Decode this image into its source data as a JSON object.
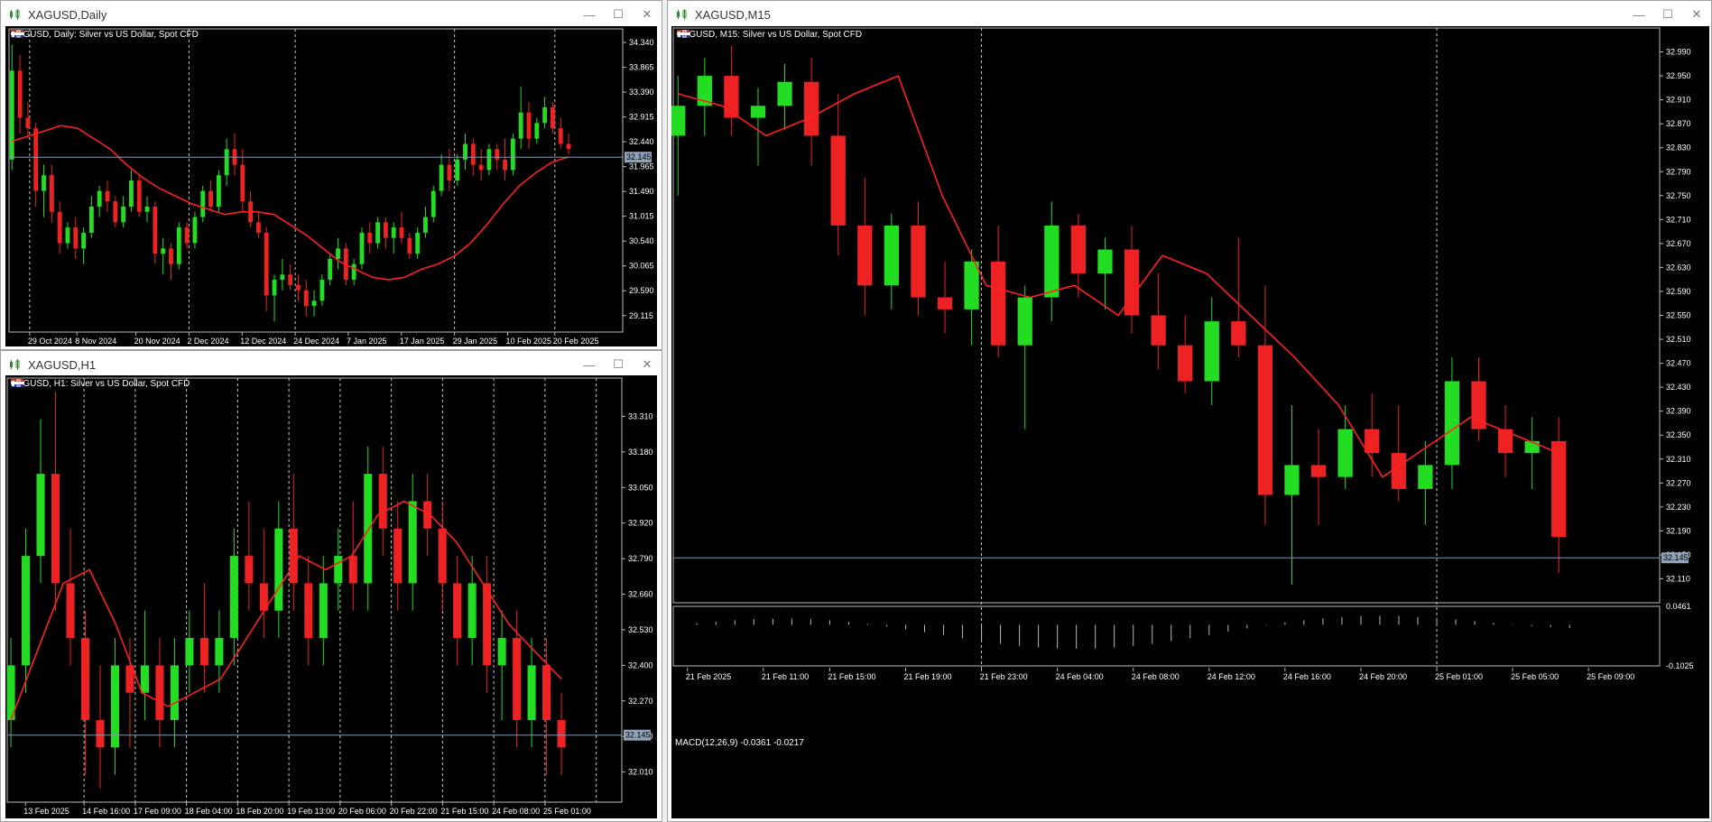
{
  "colors": {
    "bull": "#22dd22",
    "bear": "#ee2222",
    "ma": "#ff2020",
    "grid": "#c8c8c8",
    "bg": "#000000",
    "axis_text": "#ffffff",
    "price_badge": "#8fa3b8"
  },
  "windows": {
    "daily": {
      "title": "XAGUSD,Daily",
      "caption": "XAGUSD, Daily:  Silver vs US Dollar, Spot CFD",
      "price_label": "32.145"
    },
    "h1": {
      "title": "XAGUSD,H1",
      "caption": "XAGUSD, H1:  Silver vs US Dollar, Spot CFD",
      "price_label": "32.145"
    },
    "m15": {
      "title": "XAGUSD,M15",
      "caption": "XAGUSD, M15:  Silver vs US Dollar, Spot CFD",
      "price_label": "32.145",
      "macd_caption": "MACD(12,26,9) -0.0361 -0.0217"
    }
  },
  "chart_data": [
    {
      "id": "daily",
      "type": "candlestick",
      "ylim": [
        28.8,
        34.6
      ],
      "yticks": [
        34.34,
        33.865,
        33.39,
        32.915,
        32.44,
        31.965,
        31.49,
        31.015,
        30.54,
        30.065,
        29.59,
        29.115
      ],
      "xticks": [
        {
          "label": "29 Oct 2024",
          "bar": 3
        },
        {
          "label": "8 Nov 2024",
          "bar": 11
        },
        {
          "label": "20 Nov 2024",
          "bar": 21
        },
        {
          "label": "2 Dec 2024",
          "bar": 30
        },
        {
          "label": "12 Dec 2024",
          "bar": 39
        },
        {
          "label": "24 Dec 2024",
          "bar": 48
        },
        {
          "label": "7 Jan 2025",
          "bar": 57
        },
        {
          "label": "17 Jan 2025",
          "bar": 66
        },
        {
          "label": "29 Jan 2025",
          "bar": 75
        },
        {
          "label": "10 Feb 2025",
          "bar": 84
        },
        {
          "label": "20 Feb 2025",
          "bar": 92
        }
      ],
      "vgrid_bars": [
        3,
        30,
        48,
        75,
        92
      ],
      "bars_total": 104,
      "last_price": 32.145,
      "ma": [
        32.45,
        32.55,
        32.65,
        32.75,
        32.7,
        32.5,
        32.3,
        32.0,
        31.75,
        31.55,
        31.4,
        31.25,
        31.15,
        31.05,
        31.1,
        31.1,
        31.05,
        30.85,
        30.65,
        30.4,
        30.15,
        30.0,
        29.85,
        29.8,
        29.85,
        30.0,
        30.1,
        30.25,
        30.5,
        30.85,
        31.25,
        31.6,
        31.85,
        32.05,
        32.15
      ],
      "candles": [
        [
          32.1,
          34.3,
          31.9,
          33.8
        ],
        [
          33.8,
          34.1,
          32.6,
          32.9
        ],
        [
          32.9,
          33.2,
          32.5,
          32.7
        ],
        [
          32.7,
          32.8,
          31.2,
          31.5
        ],
        [
          31.5,
          32.0,
          31.0,
          31.8
        ],
        [
          31.8,
          32.0,
          30.9,
          31.1
        ],
        [
          31.1,
          31.3,
          30.3,
          30.5
        ],
        [
          30.5,
          30.9,
          30.4,
          30.8
        ],
        [
          30.8,
          31.0,
          30.2,
          30.4
        ],
        [
          30.4,
          30.8,
          30.1,
          30.7
        ],
        [
          30.7,
          31.4,
          30.6,
          31.2
        ],
        [
          31.2,
          31.6,
          31.0,
          31.5
        ],
        [
          31.5,
          31.7,
          31.1,
          31.3
        ],
        [
          31.3,
          31.4,
          30.8,
          30.9
        ],
        [
          30.9,
          31.4,
          30.8,
          31.2
        ],
        [
          31.2,
          31.9,
          31.1,
          31.7
        ],
        [
          31.7,
          31.8,
          31.0,
          31.1
        ],
        [
          31.1,
          31.4,
          30.9,
          31.2
        ],
        [
          31.2,
          31.3,
          30.1,
          30.3
        ],
        [
          30.3,
          30.6,
          29.9,
          30.4
        ],
        [
          30.4,
          30.5,
          29.8,
          30.1
        ],
        [
          30.1,
          30.9,
          30.0,
          30.8
        ],
        [
          30.8,
          30.9,
          30.4,
          30.5
        ],
        [
          30.5,
          31.1,
          30.4,
          31.0
        ],
        [
          31.0,
          31.6,
          30.9,
          31.5
        ],
        [
          31.5,
          31.7,
          31.1,
          31.2
        ],
        [
          31.2,
          31.9,
          31.1,
          31.8
        ],
        [
          31.8,
          32.5,
          31.6,
          32.3
        ],
        [
          32.3,
          32.6,
          31.8,
          32.0
        ],
        [
          32.0,
          32.3,
          31.1,
          31.3
        ],
        [
          31.3,
          31.5,
          30.8,
          30.9
        ],
        [
          30.9,
          31.1,
          30.6,
          30.7
        ],
        [
          30.7,
          30.8,
          29.2,
          29.5
        ],
        [
          29.5,
          29.9,
          29.0,
          29.8
        ],
        [
          29.8,
          30.2,
          29.6,
          29.9
        ],
        [
          29.9,
          30.1,
          29.6,
          29.7
        ],
        [
          29.7,
          29.9,
          29.4,
          29.6
        ],
        [
          29.6,
          29.8,
          29.1,
          29.3
        ],
        [
          29.3,
          29.6,
          29.1,
          29.4
        ],
        [
          29.4,
          29.9,
          29.3,
          29.8
        ],
        [
          29.8,
          30.3,
          29.7,
          30.2
        ],
        [
          30.2,
          30.6,
          30.0,
          30.4
        ],
        [
          30.4,
          30.5,
          29.7,
          29.8
        ],
        [
          29.8,
          30.2,
          29.7,
          30.1
        ],
        [
          30.1,
          30.8,
          30.0,
          30.7
        ],
        [
          30.7,
          30.9,
          30.3,
          30.5
        ],
        [
          30.5,
          31.0,
          30.4,
          30.9
        ],
        [
          30.9,
          31.0,
          30.4,
          30.6
        ],
        [
          30.6,
          30.9,
          30.3,
          30.8
        ],
        [
          30.8,
          31.1,
          30.5,
          30.6
        ],
        [
          30.6,
          30.7,
          30.2,
          30.3
        ],
        [
          30.3,
          30.8,
          30.2,
          30.7
        ],
        [
          30.7,
          31.2,
          30.6,
          31.0
        ],
        [
          31.0,
          31.6,
          30.9,
          31.5
        ],
        [
          31.5,
          32.2,
          31.4,
          32.0
        ],
        [
          32.0,
          32.3,
          31.5,
          31.7
        ],
        [
          31.7,
          32.2,
          31.6,
          32.1
        ],
        [
          32.1,
          32.6,
          31.9,
          32.4
        ],
        [
          32.4,
          32.5,
          31.8,
          32.0
        ],
        [
          32.0,
          32.3,
          31.7,
          31.9
        ],
        [
          31.9,
          32.4,
          31.8,
          32.3
        ],
        [
          32.3,
          32.4,
          31.9,
          32.1
        ],
        [
          32.1,
          32.5,
          31.7,
          31.9
        ],
        [
          31.9,
          32.6,
          31.8,
          32.5
        ],
        [
          32.5,
          33.5,
          32.3,
          33.0
        ],
        [
          33.0,
          33.2,
          32.3,
          32.5
        ],
        [
          32.5,
          32.9,
          32.4,
          32.8
        ],
        [
          32.8,
          33.3,
          32.7,
          33.1
        ],
        [
          33.1,
          33.2,
          32.6,
          32.7
        ],
        [
          32.7,
          32.9,
          32.3,
          32.4
        ],
        [
          32.4,
          32.6,
          32.2,
          32.3
        ]
      ]
    },
    {
      "id": "h1",
      "type": "candlestick",
      "ylim": [
        31.9,
        33.45
      ],
      "yticks": [
        33.31,
        33.18,
        33.05,
        32.92,
        32.79,
        32.66,
        32.53,
        32.4,
        32.27,
        32.14,
        32.01
      ],
      "xticks": [
        {
          "label": "13 Feb 2025",
          "bar": 2
        },
        {
          "label": "14 Feb 16:00",
          "bar": 10
        },
        {
          "label": "17 Feb 09:00",
          "bar": 17
        },
        {
          "label": "18 Feb 04:00",
          "bar": 24
        },
        {
          "label": "18 Feb 20:00",
          "bar": 31
        },
        {
          "label": "19 Feb 13:00",
          "bar": 38
        },
        {
          "label": "20 Feb 06:00",
          "bar": 45
        },
        {
          "label": "20 Feb 22:00",
          "bar": 52
        },
        {
          "label": "21 Feb 15:00",
          "bar": 59
        },
        {
          "label": "24 Feb 08:00",
          "bar": 66
        },
        {
          "label": "25 Feb 01:00",
          "bar": 73
        }
      ],
      "vgrid_bars": [
        10,
        17,
        24,
        31,
        38,
        45,
        52,
        59,
        66,
        73,
        80
      ],
      "bars_total": 84,
      "last_price": 32.145,
      "ma": [
        32.2,
        32.45,
        32.7,
        32.75,
        32.55,
        32.3,
        32.25,
        32.3,
        32.35,
        32.5,
        32.65,
        32.8,
        32.75,
        32.8,
        32.95,
        33.0,
        32.95,
        32.85,
        32.7,
        32.55,
        32.45,
        32.35
      ],
      "candles": [
        [
          32.2,
          32.5,
          32.1,
          32.4
        ],
        [
          32.4,
          32.9,
          32.3,
          32.8
        ],
        [
          32.8,
          33.3,
          32.7,
          33.1
        ],
        [
          33.1,
          33.4,
          32.6,
          32.7
        ],
        [
          32.7,
          32.9,
          32.4,
          32.5
        ],
        [
          32.5,
          32.6,
          32.0,
          32.2
        ],
        [
          32.2,
          32.4,
          31.95,
          32.1
        ],
        [
          32.1,
          32.5,
          32.0,
          32.4
        ],
        [
          32.4,
          32.5,
          32.1,
          32.3
        ],
        [
          32.3,
          32.6,
          32.2,
          32.4
        ],
        [
          32.4,
          32.5,
          32.1,
          32.2
        ],
        [
          32.2,
          32.5,
          32.1,
          32.4
        ],
        [
          32.4,
          32.6,
          32.3,
          32.5
        ],
        [
          32.5,
          32.7,
          32.3,
          32.4
        ],
        [
          32.4,
          32.6,
          32.3,
          32.5
        ],
        [
          32.5,
          32.9,
          32.4,
          32.8
        ],
        [
          32.8,
          33.0,
          32.6,
          32.7
        ],
        [
          32.7,
          32.9,
          32.5,
          32.6
        ],
        [
          32.6,
          33.0,
          32.5,
          32.9
        ],
        [
          32.9,
          33.1,
          32.6,
          32.7
        ],
        [
          32.7,
          32.8,
          32.4,
          32.5
        ],
        [
          32.5,
          32.8,
          32.4,
          32.7
        ],
        [
          32.7,
          32.9,
          32.6,
          32.8
        ],
        [
          32.8,
          33.0,
          32.6,
          32.7
        ],
        [
          32.7,
          33.2,
          32.6,
          33.1
        ],
        [
          33.1,
          33.2,
          32.8,
          32.9
        ],
        [
          32.9,
          33.0,
          32.6,
          32.7
        ],
        [
          32.7,
          33.1,
          32.6,
          33.0
        ],
        [
          33.0,
          33.1,
          32.8,
          32.9
        ],
        [
          32.9,
          33.0,
          32.6,
          32.7
        ],
        [
          32.7,
          32.8,
          32.4,
          32.5
        ],
        [
          32.5,
          32.8,
          32.4,
          32.7
        ],
        [
          32.7,
          32.8,
          32.3,
          32.4
        ],
        [
          32.4,
          32.6,
          32.2,
          32.5
        ],
        [
          32.5,
          32.6,
          32.1,
          32.2
        ],
        [
          32.2,
          32.5,
          32.1,
          32.4
        ],
        [
          32.4,
          32.5,
          32.0,
          32.2
        ],
        [
          32.2,
          32.3,
          32.0,
          32.1
        ]
      ]
    },
    {
      "id": "m15",
      "type": "candlestick",
      "ylim": [
        32.07,
        33.03
      ],
      "yticks": [
        32.99,
        32.95,
        32.91,
        32.87,
        32.83,
        32.79,
        32.75,
        32.71,
        32.67,
        32.63,
        32.59,
        32.55,
        32.51,
        32.47,
        32.43,
        32.39,
        32.35,
        32.31,
        32.27,
        32.23,
        32.19,
        32.15,
        32.11
      ],
      "xticks": [
        {
          "label": "21 Feb 2025",
          "bar": 1
        },
        {
          "label": "21 Feb 11:00",
          "bar": 9
        },
        {
          "label": "21 Feb 15:00",
          "bar": 16
        },
        {
          "label": "21 Feb 19:00",
          "bar": 24
        },
        {
          "label": "21 Feb 23:00",
          "bar": 32
        },
        {
          "label": "24 Feb 04:00",
          "bar": 40
        },
        {
          "label": "24 Feb 08:00",
          "bar": 48
        },
        {
          "label": "24 Feb 12:00",
          "bar": 56
        },
        {
          "label": "24 Feb 16:00",
          "bar": 64
        },
        {
          "label": "24 Feb 20:00",
          "bar": 72
        },
        {
          "label": "25 Feb 01:00",
          "bar": 80
        },
        {
          "label": "25 Feb 05:00",
          "bar": 88
        },
        {
          "label": "25 Feb 09:00",
          "bar": 96
        }
      ],
      "vgrid_bars": [
        32,
        80
      ],
      "bars_total": 104,
      "last_price": 32.145,
      "macd": {
        "ylim": [
          -0.1025,
          0.0461
        ],
        "yticks": [
          0.0461,
          -0.1025
        ]
      },
      "ma": [
        32.92,
        32.9,
        32.85,
        32.88,
        32.92,
        32.95,
        32.75,
        32.6,
        32.58,
        32.6,
        32.55,
        32.65,
        32.62,
        32.55,
        32.48,
        32.4,
        32.28,
        32.33,
        32.38,
        32.35,
        32.32
      ],
      "candles": [
        [
          32.85,
          32.95,
          32.75,
          32.9
        ],
        [
          32.9,
          32.98,
          32.85,
          32.95
        ],
        [
          32.95,
          33.0,
          32.85,
          32.88
        ],
        [
          32.88,
          32.93,
          32.8,
          32.9
        ],
        [
          32.9,
          32.97,
          32.86,
          32.94
        ],
        [
          32.94,
          32.98,
          32.8,
          32.85
        ],
        [
          32.85,
          32.92,
          32.65,
          32.7
        ],
        [
          32.7,
          32.78,
          32.55,
          32.6
        ],
        [
          32.6,
          32.72,
          32.56,
          32.7
        ],
        [
          32.7,
          32.74,
          32.55,
          32.58
        ],
        [
          32.58,
          32.64,
          32.52,
          32.56
        ],
        [
          32.56,
          32.66,
          32.5,
          32.64
        ],
        [
          32.64,
          32.7,
          32.48,
          32.5
        ],
        [
          32.5,
          32.6,
          32.36,
          32.58
        ],
        [
          32.58,
          32.74,
          32.54,
          32.7
        ],
        [
          32.7,
          32.72,
          32.58,
          32.62
        ],
        [
          32.62,
          32.68,
          32.56,
          32.66
        ],
        [
          32.66,
          32.7,
          32.52,
          32.55
        ],
        [
          32.55,
          32.62,
          32.46,
          32.5
        ],
        [
          32.5,
          32.55,
          32.42,
          32.44
        ],
        [
          32.44,
          32.58,
          32.4,
          32.54
        ],
        [
          32.54,
          32.68,
          32.48,
          32.5
        ],
        [
          32.5,
          32.6,
          32.2,
          32.25
        ],
        [
          32.25,
          32.4,
          32.1,
          32.3
        ],
        [
          32.3,
          32.36,
          32.2,
          32.28
        ],
        [
          32.28,
          32.4,
          32.26,
          32.36
        ],
        [
          32.36,
          32.42,
          32.28,
          32.32
        ],
        [
          32.32,
          32.4,
          32.24,
          32.26
        ],
        [
          32.26,
          32.34,
          32.2,
          32.3
        ],
        [
          32.3,
          32.48,
          32.26,
          32.44
        ],
        [
          32.44,
          32.48,
          32.34,
          32.36
        ],
        [
          32.36,
          32.4,
          32.28,
          32.32
        ],
        [
          32.32,
          32.38,
          32.26,
          32.34
        ],
        [
          32.34,
          32.38,
          32.12,
          32.18
        ]
      ]
    }
  ]
}
